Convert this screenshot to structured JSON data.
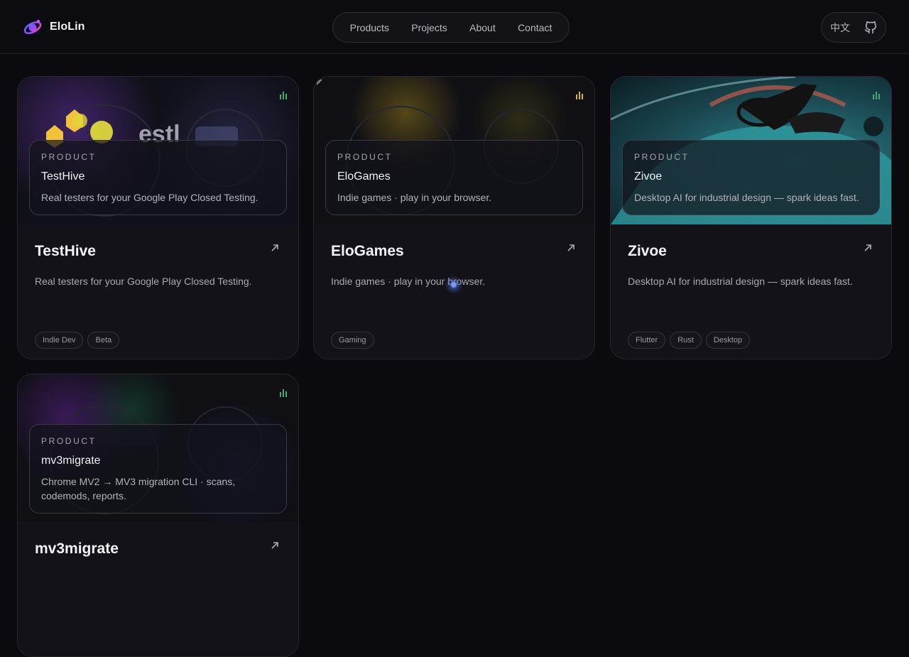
{
  "brand": {
    "name": "EloLin"
  },
  "nav": {
    "items": [
      "Products",
      "Projects",
      "About",
      "Contact"
    ]
  },
  "tools": {
    "language": "中文",
    "github_icon": "github-icon"
  },
  "cards": [
    {
      "eyebrow": "PRODUCT",
      "overlay_title": "TestHive",
      "overlay_desc": "Real testers for your Google Play Closed Testing.",
      "title": "TestHive",
      "desc": "Real testers for your Google Play Closed Testing.",
      "tags": [
        "Indie Dev",
        "Beta"
      ]
    },
    {
      "eyebrow": "PRODUCT",
      "overlay_title": "EloGames",
      "overlay_desc": "Indie games · play in your browser.",
      "title": "EloGames",
      "desc": "Indie games · play in your browser.",
      "tags": [
        "Gaming"
      ]
    },
    {
      "eyebrow": "PRODUCT",
      "overlay_title": "Zivoe",
      "overlay_desc": "Desktop AI for industrial design — spark ideas fast.",
      "title": "Zivoe",
      "desc": "Desktop AI for industrial design — spark ideas fast.",
      "tags": [
        "Flutter",
        "Rust",
        "Desktop"
      ]
    },
    {
      "eyebrow": "PRODUCT",
      "overlay_title": "mv3migrate",
      "overlay_desc": "Chrome MV2 → MV3 migration CLI · scans, codemods, reports.",
      "title": "mv3migrate",
      "desc": "",
      "tags": []
    }
  ],
  "colors": {
    "background": "#0b0b0f",
    "card": "#0f0f14",
    "accent_bars": "#3fae6b"
  }
}
